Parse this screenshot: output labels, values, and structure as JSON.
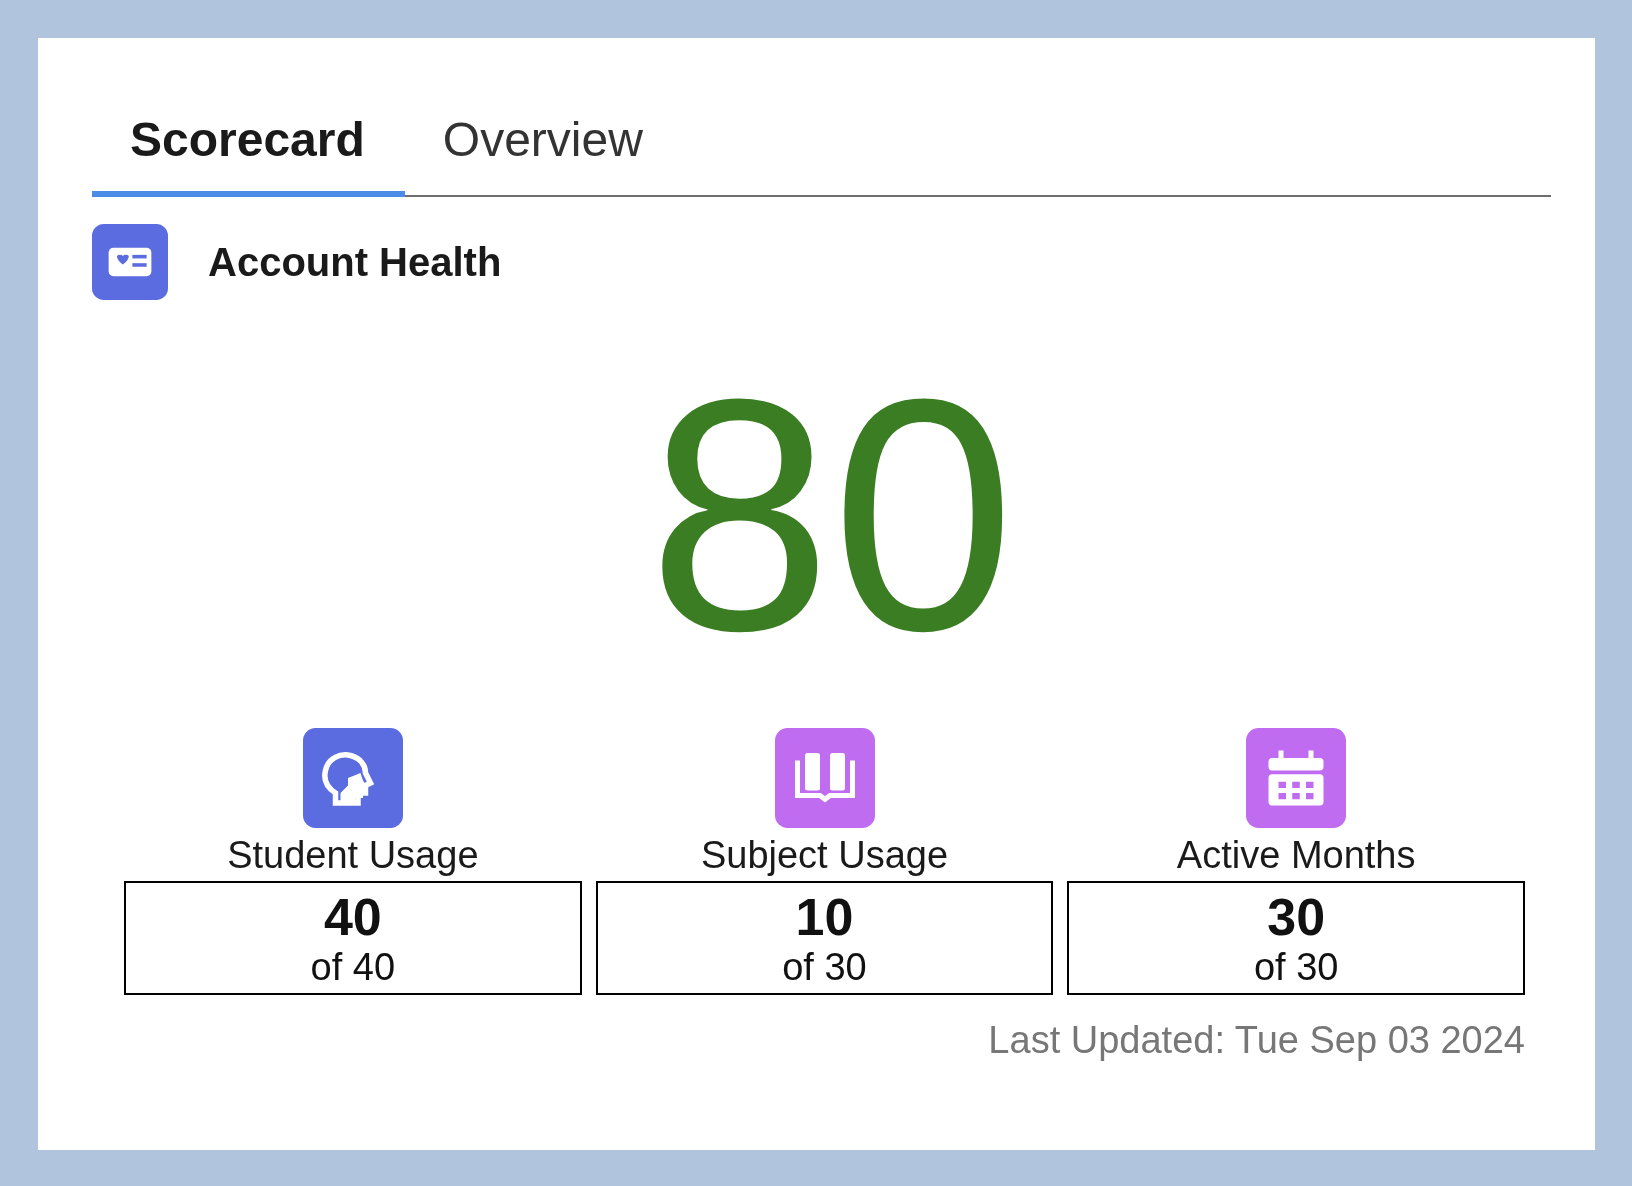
{
  "tabs": [
    {
      "label": "Scorecard",
      "selected": true
    },
    {
      "label": "Overview",
      "selected": false
    }
  ],
  "header": {
    "title": "Account Health"
  },
  "score": {
    "value": "80"
  },
  "metrics": [
    {
      "kind": "head",
      "color": "#5b6be0",
      "label": "Student Usage",
      "value": "40",
      "total": "of 40"
    },
    {
      "kind": "book",
      "color": "#c06cf0",
      "label": "Subject Usage",
      "value": "10",
      "total": "of 30"
    },
    {
      "kind": "calendar",
      "color": "#c06cf0",
      "label": "Active Months",
      "value": "30",
      "total": "of 30"
    }
  ],
  "footer": {
    "last_updated": "Last Updated: Tue Sep 03 2024"
  }
}
